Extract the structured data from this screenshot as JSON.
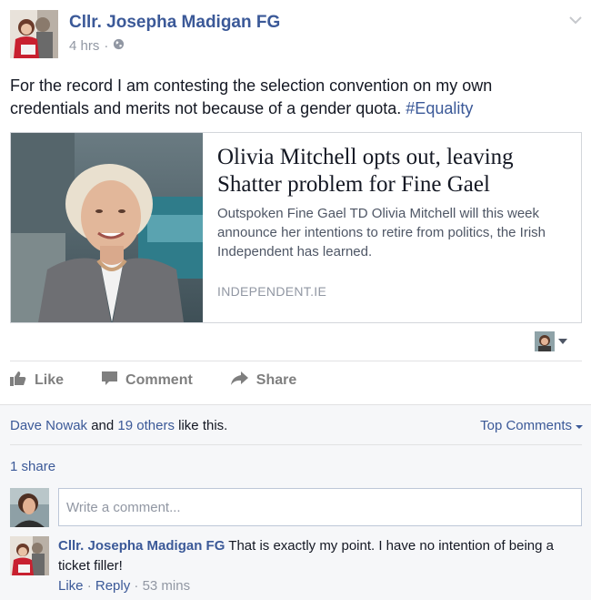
{
  "post": {
    "author": "Cllr. Josepha Madigan FG",
    "time": "4 hrs",
    "meta_separator": "·",
    "text": "For the record I am contesting the selection convention on my own credentials and merits not because of a gender quota.",
    "hashtag": "#Equality"
  },
  "link_card": {
    "title": "Olivia Mitchell opts out, leaving Shatter problem for Fine Gael",
    "description": "Outspoken Fine Gael TD Olivia Mitchell will this week announce her intentions to retire from politics, the Irish Independent has learned.",
    "source": "INDEPENDENT.IE"
  },
  "actions": {
    "like": "Like",
    "comment": "Comment",
    "share": "Share"
  },
  "feedback": {
    "liker": "Dave Nowak",
    "and": "and",
    "others": "19 others",
    "like_this": "like this.",
    "top_comments": "Top Comments",
    "shares": "1 share",
    "comment_placeholder": "Write a comment..."
  },
  "comment": {
    "author": "Cllr. Josepha Madigan FG",
    "text": "That is exactly my point. I have no intention of being a ticket filler!",
    "like": "Like",
    "reply": "Reply",
    "time": "53 mins",
    "separator": "·"
  },
  "colors": {
    "link": "#3b5998",
    "muted": "#9197a3",
    "text": "#141823",
    "feedback_bg": "#f6f7f9"
  },
  "icons": [
    "globe-icon",
    "chevron-down-icon",
    "like-icon",
    "comment-icon",
    "share-icon",
    "caret-down-icon"
  ]
}
